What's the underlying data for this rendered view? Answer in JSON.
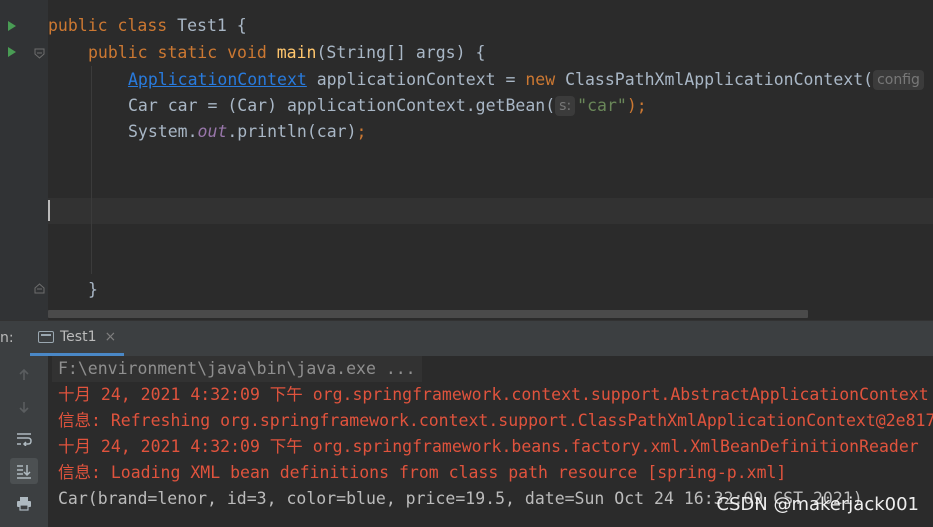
{
  "editor": {
    "lines": [
      [
        "public class ",
        "Test1",
        " {"
      ],
      [
        "public static void ",
        "main",
        "(String[] args) {"
      ],
      [
        "ApplicationContext",
        " applicationContext = ",
        "new ",
        "ClassPathXmlApplicationContext(",
        "config"
      ],
      [
        "Car car = (Car) applicationContext.getBean(",
        "s:",
        "\"car\"",
        ");"
      ],
      [
        "System.",
        "out",
        ".println(car)",
        ";"
      ],
      [
        "}"
      ]
    ]
  },
  "run_window": {
    "label": "n:",
    "tab_label": "Test1",
    "tab_close": "×"
  },
  "console": {
    "lines": [
      "F:\\environment\\java\\bin\\java.exe ...",
      "十月 24, 2021 4:32:09 下午 org.springframework.context.support.AbstractApplicationContext",
      "信息: Refreshing org.springframework.context.support.ClassPathXmlApplicationContext@2e817",
      "十月 24, 2021 4:32:09 下午 org.springframework.beans.factory.xml.XmlBeanDefinitionReader",
      "信息: Loading XML bean definitions from class path resource [spring-p.xml]",
      "Car(brand=lenor, id=3, color=blue, price=19.5, date=Sun Oct 24 16:32:09 CST 2021)"
    ]
  },
  "watermark": "CSDN @makerjack001",
  "toolbar_icons": [
    "arrow-up-icon",
    "arrow-down-icon",
    "soft-wrap-icon",
    "scroll-to-end-icon",
    "print-icon"
  ],
  "colors": {
    "keyword": "#cc7832",
    "method": "#ffc66d",
    "string": "#6a8759",
    "error_text": "#e0533d",
    "background": "#2b2b2b"
  }
}
